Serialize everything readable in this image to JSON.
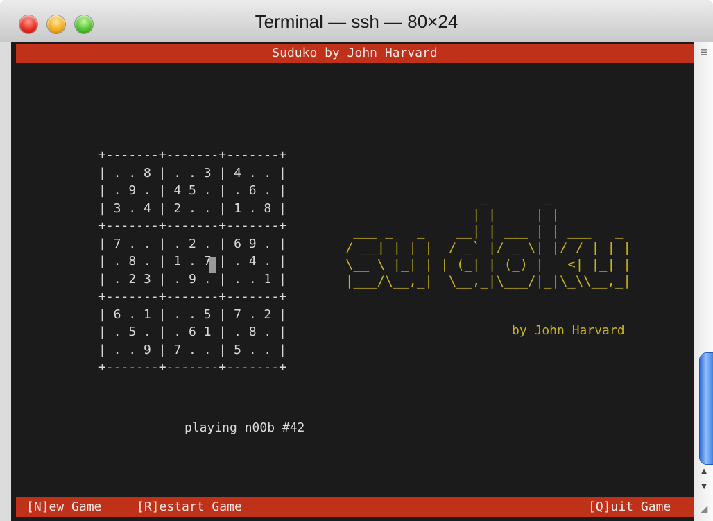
{
  "window": {
    "title": "Terminal — ssh — 80×24"
  },
  "header_bar": {
    "text": "Suduko by John Harvard"
  },
  "board": {
    "ascii": "+-------+-------+-------+\n| . . 8 | . . 3 | 4 . . |\n| . 9 . | 4 5 . | . 6 . |\n| 3 . 4 | 2 . . | 1 . 8 |\n+-------+-------+-------+\n| 7 . . | . 2 . | 6 9 . |\n| . 8 . | 1 . 7 | . 4 . |\n| . 2 3 | . 9 . | . . 1 |\n+-------+-------+-------+\n| 6 . 1 | . . 5 | 7 . 2 |\n| . 5 . | . 6 1 | . 8 . |\n| . . 9 | 7 . . | 5 . . |\n+-------+-------+-------+"
  },
  "logo": {
    "ascii": "                 _       _\n                | |     | |\n ___ _   _    __| | ___ | | ___   _\n/ __| | | |  / _` |/ _ \\| |/ / | | |\n\\__ \\ |_| | | (_| | (_) |   <| |_| |\n|___/\\__,_|  \\__,_|\\___/|_|\\_\\\\__,_|"
  },
  "byline": "by John Harvard",
  "status": "playing n00b #42",
  "footer_bar": {
    "new_game": "[N]ew Game",
    "restart_game": "[R]estart Game",
    "quit_game": "[Q]uit Game"
  },
  "colors": {
    "bar_red": "#c0311a",
    "logo_yellow": "#c9b31c",
    "terminal_bg": "#1b1b1b"
  },
  "icons": [
    "close-icon",
    "minimize-icon",
    "zoom-icon",
    "scrollbar-grip-icon",
    "scroll-up-icon",
    "scroll-down-icon",
    "resize-grip-icon"
  ]
}
